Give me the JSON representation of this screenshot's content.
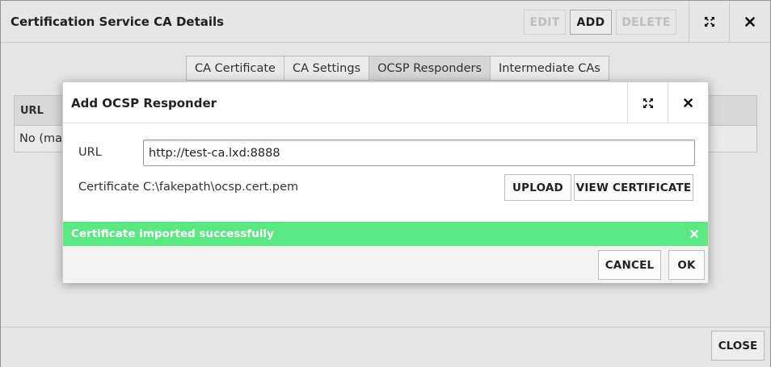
{
  "outer": {
    "title": "Certification Service CA Details",
    "buttons": {
      "edit": "EDIT",
      "add": "ADD",
      "delete": "DELETE"
    },
    "tabs": [
      "CA Certificate",
      "CA Settings",
      "OCSP Responders",
      "Intermediate CAs"
    ],
    "active_tab": "OCSP Responders",
    "table": {
      "header": "URL",
      "empty_row": "No (mat"
    },
    "close_label": "CLOSE"
  },
  "modal": {
    "title": "Add OCSP Responder",
    "url_label": "URL",
    "url_value": "http://test-ca.lxd:8888",
    "certificate_label": "Certificate",
    "certificate_value": "C:\\fakepath\\ocsp.cert.pem",
    "upload_label": "UPLOAD",
    "view_certificate_label": "VIEW CERTIFICATE",
    "notice": "Certificate imported successfully",
    "cancel_label": "CANCEL",
    "ok_label": "OK"
  },
  "colors": {
    "success": "#59e882",
    "active_tab": "#e2e2e2"
  }
}
